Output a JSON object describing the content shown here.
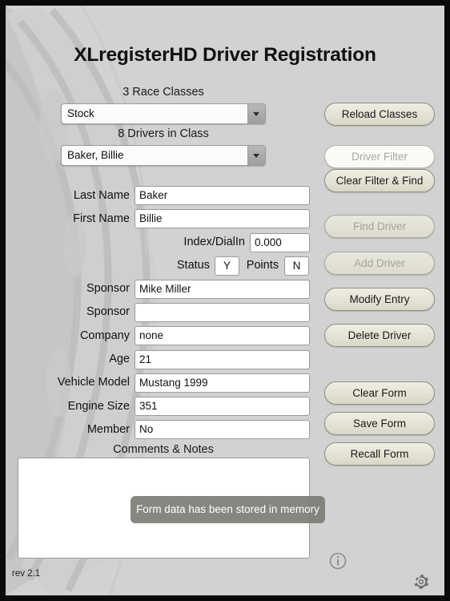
{
  "app": {
    "title": "XLregisterHD Driver Registration",
    "revision": "rev 2.1"
  },
  "selectors": {
    "class_label": "3 Race Classes",
    "class_value": "Stock",
    "driver_label": "8 Drivers in Class",
    "driver_value": "Baker, Billie"
  },
  "form": {
    "fields": [
      {
        "label": "Last Name",
        "value": "Baker"
      },
      {
        "label": "First Name",
        "value": "Billie"
      },
      {
        "label": "Index/DialIn",
        "value": "0.000"
      },
      {
        "label": "Status",
        "value": "Y"
      },
      {
        "label": "Points",
        "value": "N"
      },
      {
        "label": "Sponsor",
        "value": "Mike Miller"
      },
      {
        "label": "Sponsor",
        "value": ""
      },
      {
        "label": "Company",
        "value": "none"
      },
      {
        "label": "Age",
        "value": "21"
      },
      {
        "label": "Vehicle Model",
        "value": "Mustang 1999"
      },
      {
        "label": "Engine Size",
        "value": "351"
      },
      {
        "label": "Member",
        "value": "No"
      }
    ],
    "comments_label": "Comments & Notes",
    "comments_value": ""
  },
  "buttons": {
    "reload_classes": "Reload Classes",
    "driver_filter_placeholder": "Driver Filter",
    "driver_filter_value": "",
    "clear_filter_find": "Clear Filter & Find",
    "find_driver": "Find Driver",
    "add_driver": "Add Driver",
    "modify_entry": "Modify Entry",
    "delete_driver": "Delete Driver",
    "clear_form": "Clear Form",
    "save_form": "Save Form",
    "recall_form": "Recall Form"
  },
  "toast": {
    "message": "Form data has been stored in memory"
  },
  "icons": {
    "info": "info-icon",
    "gear": "gear-icon"
  },
  "colors": {
    "screen_bg": "#d2d2d2",
    "button_face": "#e8e7da",
    "toast_bg": "#7e7e78",
    "bezel": "#0a0a0a"
  }
}
